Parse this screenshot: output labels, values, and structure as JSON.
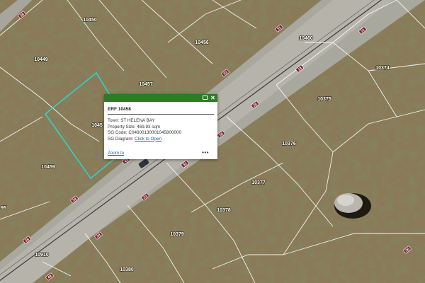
{
  "map": {
    "parcels": [
      {
        "id": "10450"
      },
      {
        "id": "10456"
      },
      {
        "id": "10460"
      },
      {
        "id": "10449"
      },
      {
        "id": "10374"
      },
      {
        "id": "10457"
      },
      {
        "id": "10375"
      },
      {
        "id": "10458",
        "partial": "1045"
      },
      {
        "id": "10376"
      },
      {
        "id": "10459"
      },
      {
        "id": "10377"
      },
      {
        "id": "10378"
      },
      {
        "id": "10379"
      },
      {
        "id": "10910"
      },
      {
        "id": "10380"
      },
      {
        "id": "95"
      }
    ],
    "road_markers": [
      "38",
      "31",
      "33",
      "21",
      "19",
      "35",
      "26",
      "32",
      "23",
      "28",
      "28",
      "26",
      "42",
      "49",
      "36"
    ],
    "selected_parcel": "10458"
  },
  "popup": {
    "title": "ERF 10458",
    "town_label": "Town:",
    "town_value": "ST HELENA BAY",
    "size_label": "Property Size:",
    "size_value": "469.93 sqm",
    "sg_code_label": "SG Code:",
    "sg_code_value": "C04600130001045800000",
    "sg_diagram_label": "SG Diagram:",
    "sg_diagram_link": "Click to Open",
    "zoom_link": "Zoom to",
    "more": "•••",
    "close": "✕"
  },
  "colors": {
    "header": "#2e7b25",
    "selection": "#33d1c4",
    "link": "#1a62b8"
  }
}
